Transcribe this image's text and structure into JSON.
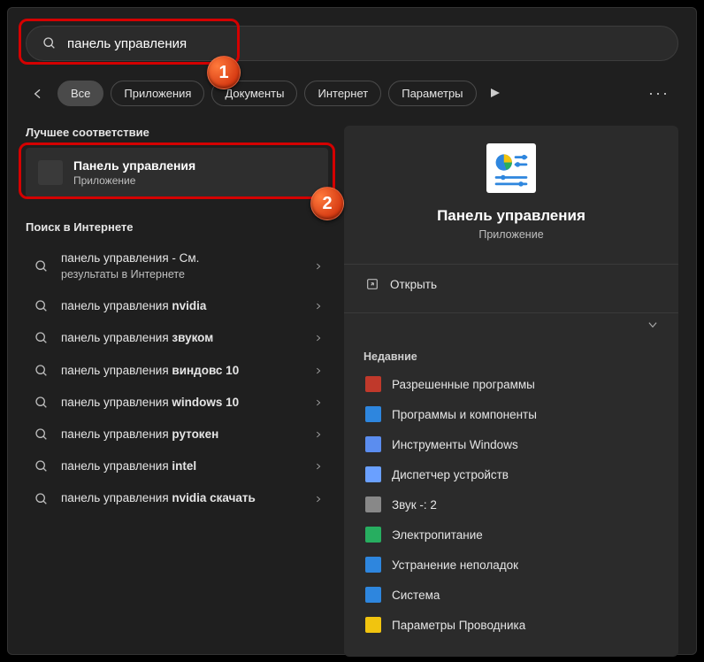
{
  "search": {
    "value": "панель управления"
  },
  "tabs": {
    "items": [
      {
        "label": "Все",
        "active": true
      },
      {
        "label": "Приложения",
        "active": false
      },
      {
        "label": "Документы",
        "active": false
      },
      {
        "label": "Интернет",
        "active": false
      },
      {
        "label": "Параметры",
        "active": false
      }
    ]
  },
  "bestMatch": {
    "heading": "Лучшее соответствие",
    "title": "Панель управления",
    "subtitle": "Приложение"
  },
  "webSearch": {
    "heading": "Поиск в Интернете",
    "items": [
      {
        "prefix": "панель управления",
        "suffix": " - См.",
        "sub": "результаты в Интернете"
      },
      {
        "prefix": "панель управления ",
        "bold": "nvidia"
      },
      {
        "prefix": "панель управления ",
        "bold": "звуком"
      },
      {
        "prefix": "панель управления ",
        "bold": "виндовс 10"
      },
      {
        "prefix": "панель управления ",
        "bold": "windows 10"
      },
      {
        "prefix": "панель управления ",
        "bold": "рутокен"
      },
      {
        "prefix": "панель управления ",
        "bold": "intel"
      },
      {
        "prefix": "панель управления ",
        "bold": "nvidia скачать"
      }
    ]
  },
  "detail": {
    "title": "Панель управления",
    "subtitle": "Приложение",
    "open": "Открыть",
    "recentHeading": "Недавние",
    "recent": [
      {
        "label": "Разрешенные программы",
        "color": "#c0392b"
      },
      {
        "label": "Программы и компоненты",
        "color": "#2e86de"
      },
      {
        "label": "Инструменты Windows",
        "color": "#5b8def"
      },
      {
        "label": "Диспетчер устройств",
        "color": "#6aa0ff"
      },
      {
        "label": "Звук -: 2",
        "color": "#888"
      },
      {
        "label": "Электропитание",
        "color": "#27ae60"
      },
      {
        "label": "Устранение неполадок",
        "color": "#2e86de"
      },
      {
        "label": "Система",
        "color": "#2e86de"
      },
      {
        "label": "Параметры Проводника",
        "color": "#f1c40f"
      }
    ]
  },
  "annotations": {
    "badge1": "1",
    "badge2": "2"
  }
}
